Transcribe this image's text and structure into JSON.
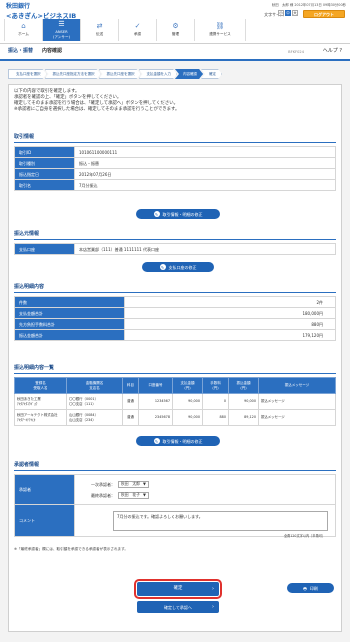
{
  "header": {
    "bank_name": "秋田銀行",
    "service_name": "<あきぎん>ビジネスIB",
    "user_line": "秋田　太郎 様",
    "last_login": "2012年07月13日 09時30分00秒",
    "font_size_label": "文字サイズ",
    "font_sizes": [
      "小",
      "中",
      "大"
    ],
    "logout_label": "ログアウト",
    "nav": [
      {
        "label": "ホーム",
        "icon": "home-icon",
        "glyph": "⌂"
      },
      {
        "label": "ANSER\n(アンサー)",
        "icon": "anser-icon",
        "glyph": "☰"
      },
      {
        "label": "伝送",
        "icon": "transfer-icon",
        "glyph": "⇄"
      },
      {
        "label": "承認",
        "icon": "approve-icon",
        "glyph": "✓"
      },
      {
        "label": "管理",
        "icon": "manage-icon",
        "glyph": "⚙"
      },
      {
        "label": "連携サービス",
        "icon": "link-icon",
        "glyph": "⛓"
      }
    ]
  },
  "titlebar": {
    "category": "振込・振替",
    "title": "内容確認",
    "screen_id": "BFKF024",
    "help_label": "ヘルプ"
  },
  "steps": [
    "支払口座を選択",
    "振込先口座指定方法を選択",
    "振込先口座を選択",
    "支払金額を入力",
    "内容確認",
    "確定"
  ],
  "active_step": 4,
  "intro": [
    "以下の内容で取引を確定します。",
    "承認者を確認の上、「確定」ボタンを押してください。",
    "確定してそのまま承認を行う場合は、「確定して承認へ」ボタンを押してください。",
    "※承認者にご自身を選択した場合は、確定してそのまま承認を行うことができます。"
  ],
  "transaction_info": {
    "section_title": "取引情報",
    "rows": [
      {
        "label": "取引ID",
        "value": "101061100000111"
      },
      {
        "label": "取引種別",
        "value": "振込・振替"
      },
      {
        "label": "振込指定日",
        "value": "2012年07月26日"
      },
      {
        "label": "取引名",
        "value": "7月分振込"
      }
    ],
    "edit_button": "取引情報・明細の修正"
  },
  "source_account": {
    "section_title": "振込元情報",
    "label": "支払口座",
    "value": "本店営業部（111）普通 1111111 代表口座",
    "edit_button": "支払口座の修正"
  },
  "details": {
    "section_title": "振込明細内容",
    "rows": [
      {
        "label": "件数",
        "value": "2件"
      },
      {
        "label": "支払金額合計",
        "value": "180,000円"
      },
      {
        "label": "先方負担手数料合計",
        "value": "880円"
      },
      {
        "label": "振込金額合計",
        "value": "179,120円"
      }
    ]
  },
  "detail_list": {
    "section_title": "振込明細内容一覧",
    "headers": [
      "登録名\n受取人名",
      "金融機関名\n支店名",
      "科目",
      "口座番号",
      "支払金額\n(円)",
      "手数料\n(円)",
      "振込金額\n(円)",
      "振込メッセージ"
    ],
    "rows": [
      [
        "秋田あきた工業\nｱｷﾀｱｷﾀｺｳｷﾞｮｳ",
        "〇〇銀行（0001）\n〇〇支店（111）",
        "普通",
        "1234567",
        "90,000",
        "0",
        "90,000",
        "振込メッセージ"
      ],
      [
        "秋田アーキテクト株式会社\nｱｷﾀｱｰｷﾃｸﾄ(ｶ",
        "山山銀行（0084）\n山山支店（234）",
        "普通",
        "2345678",
        "90,000",
        "880",
        "89,120",
        "振込メッセージ"
      ]
    ],
    "edit_button": "取引情報・明細の修正"
  },
  "approver": {
    "section_title": "承認者情報",
    "approver_label": "承認者",
    "first_label": "一次承認者：",
    "first_value": "秋田　太郎",
    "final_label": "最終承認者：",
    "final_value": "秋田　花子",
    "comment_label": "コメント",
    "comment_value": "7月分の振込です。確認よろしくお願いします。",
    "comment_limit": "全角120文字以内［半角可］",
    "note": "※「最終承認者」欄には、取引額を承認できる承認者が表示されます。"
  },
  "actions": {
    "confirm": "確定",
    "confirm_and_approve": "確定して承認へ",
    "print": "印刷"
  },
  "colors": {
    "brand_blue": "#2b6fc0",
    "highlight_red": "#e0312d",
    "logout_orange": "#f5a623"
  }
}
